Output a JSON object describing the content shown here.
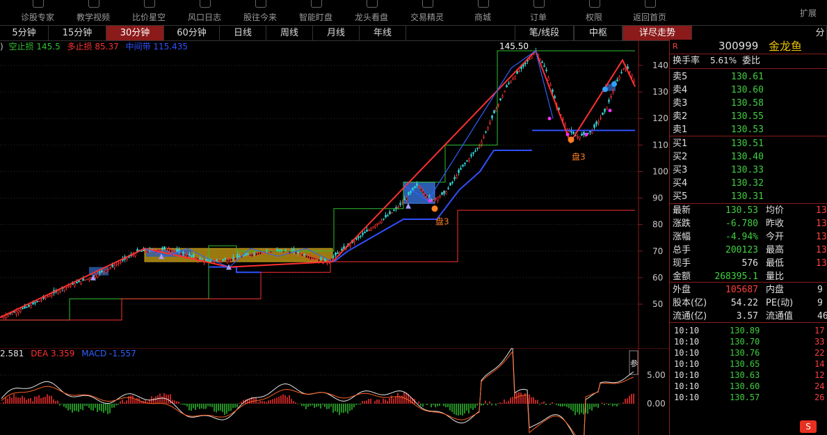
{
  "toolbar": {
    "items": [
      "诊股专家",
      "教学视频",
      "比价星空",
      "风口日志",
      "股往今来",
      "智能盯盘",
      "龙头看盘",
      "交易精灵",
      "商城",
      "订单",
      "权限",
      "返回首页"
    ],
    "expand": "扩展"
  },
  "tabs": {
    "periods": [
      "5分钟",
      "15分钟",
      "30分钟",
      "60分钟",
      "日线",
      "周线",
      "月线",
      "年线"
    ],
    "active": "30分钟",
    "right": [
      "笔/线段",
      "中枢",
      "详尽走势"
    ],
    "right_active": "详尽走势",
    "edge": "分"
  },
  "indicator": {
    "prefix": ")",
    "short_stop_label": "空止损",
    "short_stop": "145.5",
    "long_stop_label": "多止损",
    "long_stop": "85.37",
    "mid_label": "中间带",
    "mid": "115.435",
    "peak_label": "145.50",
    "pan_label": "盘3",
    "colors": {
      "short": "#30c030",
      "long": "#ff3030",
      "mid": "#3050ff"
    }
  },
  "y_axis": {
    "ticks": [
      "140",
      "130",
      "120",
      "110",
      "100",
      "90",
      "80",
      "70",
      "60",
      "50"
    ]
  },
  "macd": {
    "dif_partial": "2.581",
    "dea_label": "DEA",
    "dea": "3.359",
    "macd_label": "MACD",
    "macd": "-1.557",
    "ticks": [
      "5.00",
      "0.00"
    ],
    "param_label": "参"
  },
  "quote": {
    "flag": "R",
    "code": "300999",
    "name": "金龙鱼",
    "turnover_label": "换手率",
    "turnover": "5.61%",
    "ratio_label": "委比",
    "asks": [
      {
        "label": "卖5",
        "price": "130.61"
      },
      {
        "label": "卖4",
        "price": "130.60"
      },
      {
        "label": "卖3",
        "price": "130.58"
      },
      {
        "label": "卖2",
        "price": "130.55"
      },
      {
        "label": "卖1",
        "price": "130.53"
      }
    ],
    "bids": [
      {
        "label": "买1",
        "price": "130.51"
      },
      {
        "label": "买2",
        "price": "130.40"
      },
      {
        "label": "买3",
        "price": "130.33"
      },
      {
        "label": "买4",
        "price": "130.32"
      },
      {
        "label": "买5",
        "price": "130.31"
      }
    ],
    "stats": [
      {
        "l1": "最新",
        "v1": "130.53",
        "l2": "均价",
        "v2": "13"
      },
      {
        "l1": "涨跌",
        "v1": "-6.780",
        "l2": "昨收",
        "v2": "13"
      },
      {
        "l1": "涨幅",
        "v1": "-4.94%",
        "l2": "今开",
        "v2": "13"
      },
      {
        "l1": "总手",
        "v1": "200123",
        "l2": "最高",
        "v2": "13"
      },
      {
        "l1": "现手",
        "v1": "576",
        "l2": "最低",
        "v2": "13"
      },
      {
        "l1": "金额",
        "v1": "268395.1",
        "l2": "量比",
        "v2": ""
      }
    ],
    "stats2": [
      {
        "l1": "外盘",
        "v1": "105687",
        "l2": "内盘",
        "v2": "9"
      },
      {
        "l1": "股本(亿)",
        "v1": "54.22",
        "l2": "PE(动)",
        "v2": "9"
      },
      {
        "l1": "流通(亿)",
        "v1": "3.57",
        "l2": "流通值",
        "v2": "46"
      }
    ],
    "ticks": [
      {
        "t": "10:10",
        "p": "130.89",
        "v": "17"
      },
      {
        "t": "10:10",
        "p": "130.70",
        "v": "33"
      },
      {
        "t": "10:10",
        "p": "130.76",
        "v": "22"
      },
      {
        "t": "10:10",
        "p": "130.65",
        "v": "14"
      },
      {
        "t": "10:10",
        "p": "130.63",
        "v": "12"
      },
      {
        "t": "10:10",
        "p": "130.60",
        "v": "24"
      },
      {
        "t": "10:10",
        "p": "130.57",
        "v": "26"
      }
    ]
  },
  "logo_text": "S"
}
